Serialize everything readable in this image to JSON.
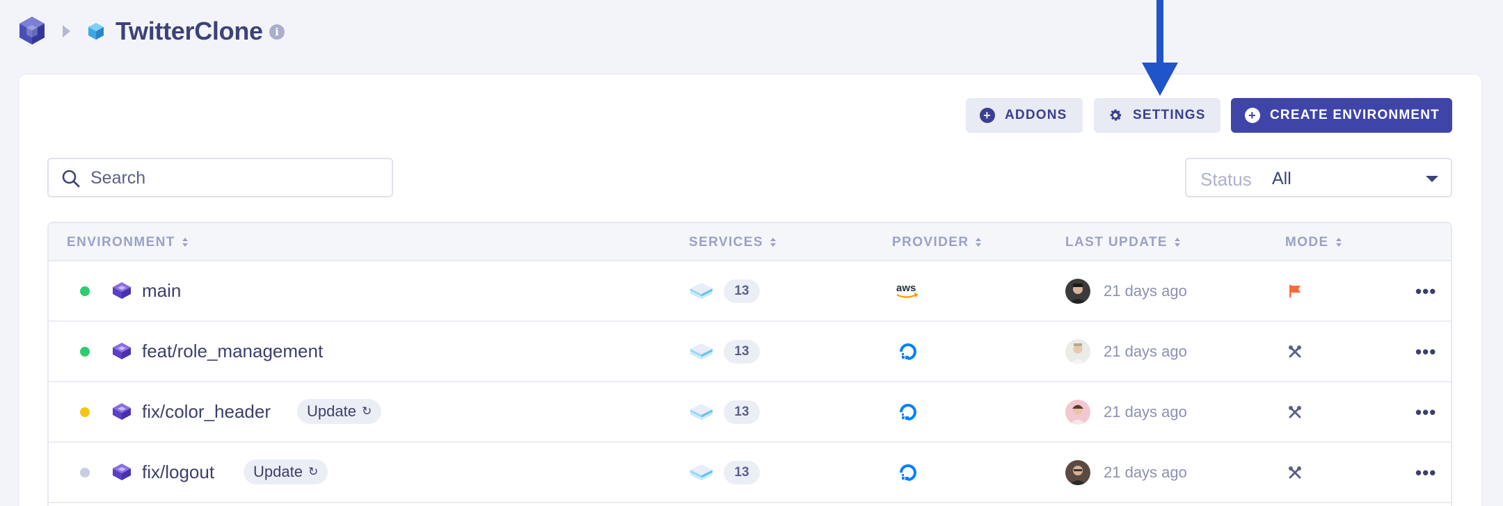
{
  "header": {
    "project_title": "TwitterClone",
    "info_glyph": "i"
  },
  "toolbar": {
    "addons_label": "ADDONS",
    "settings_label": "SETTINGS",
    "create_label": "CREATE ENVIRONMENT"
  },
  "search": {
    "placeholder": "Search",
    "value": ""
  },
  "status_filter": {
    "label": "Status",
    "value": "All"
  },
  "table": {
    "columns": [
      "ENVIRONMENT",
      "SERVICES",
      "PROVIDER",
      "LAST UPDATE",
      "MODE"
    ],
    "rows": [
      {
        "name": "main",
        "status_color": "#2ecc71",
        "badge": "",
        "services": "13",
        "provider": "aws-icon",
        "last_update": "21 days ago",
        "mode": "flag-icon"
      },
      {
        "name": "feat/role_management",
        "status_color": "#2ecc71",
        "badge": "",
        "services": "13",
        "provider": "digitalocean-icon",
        "last_update": "21 days ago",
        "mode": "tools-icon"
      },
      {
        "name": "fix/color_header",
        "status_color": "#f5c518",
        "badge": "Update",
        "services": "13",
        "provider": "digitalocean-icon",
        "last_update": "21 days ago",
        "mode": "tools-icon"
      },
      {
        "name": "fix/logout",
        "status_color": "#c8cde3",
        "badge": "Update",
        "services": "13",
        "provider": "digitalocean-icon",
        "last_update": "21 days ago",
        "mode": "tools-icon"
      }
    ]
  },
  "colors": {
    "primary": "#3f45a8",
    "annotation_arrow": "#1f55c9",
    "running": "#2ecc71",
    "pending": "#f5c518",
    "stopped": "#c8cde3",
    "flag": "#ff6a3d"
  }
}
